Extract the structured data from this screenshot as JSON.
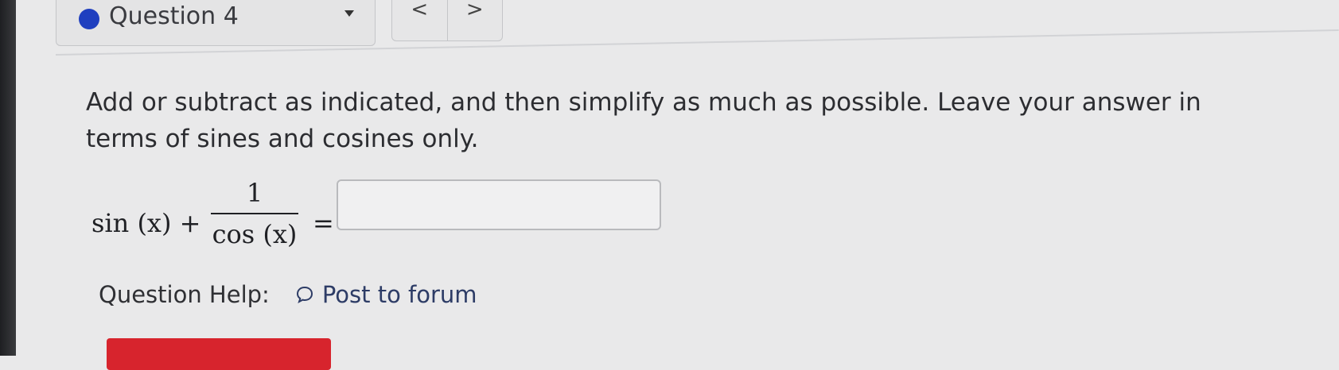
{
  "header": {
    "question_label": "Question 4",
    "dot_color": "#1f3fbf",
    "dropdown_icon": "caret-down-icon",
    "prev_label": "<",
    "next_label": ">"
  },
  "question": {
    "prompt": "Add or subtract as indicated, and then simplify as much as possible. Leave your answer in terms of sines and cosines only.",
    "expression_left": "sin (x) + ",
    "numerator": "1",
    "denominator": "cos (x)",
    "equals": "=",
    "answer_value": ""
  },
  "help": {
    "label": "Question Help:",
    "link_label": "Post to forum",
    "link_icon": "speech-bubble-icon"
  },
  "submit": {
    "color": "#d7242d"
  }
}
